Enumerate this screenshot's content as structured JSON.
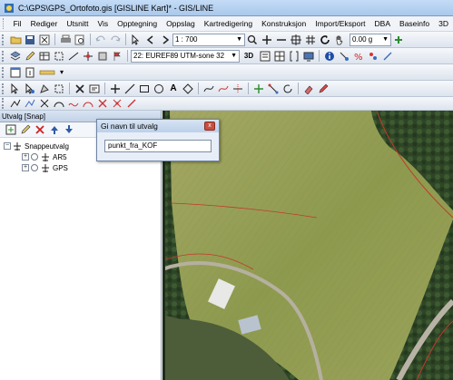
{
  "window": {
    "title": "C:\\GPS\\GPS_Ortofoto.gis [GISLINE Kart]* - GIS/LINE"
  },
  "menu": [
    "Fil",
    "Rediger",
    "Utsnitt",
    "Vis",
    "Opptegning",
    "Oppslag",
    "Kartredigering",
    "Konstruksjon",
    "Import/Eksport",
    "DBA",
    "Baseinfo",
    "3D"
  ],
  "toolbar1": {
    "scale": "1 : 700",
    "height": "0.00 g"
  },
  "toolbar2": {
    "coord_system": "22: EUREF89 UTM-sone 32"
  },
  "panel": {
    "title": "Utvalg [Snap]"
  },
  "tree": {
    "root": "Snappeutvalg",
    "children": [
      "AR5",
      "GPS"
    ]
  },
  "dialog": {
    "title": "Gi navn til utvalg",
    "input_value": "punkt_fra_KOF",
    "close_label": "x"
  },
  "colors": {
    "accent": "#3b6fb6",
    "field": "#9aa25a",
    "forest": "#2f4a28",
    "property_line": "#c23a2a"
  }
}
